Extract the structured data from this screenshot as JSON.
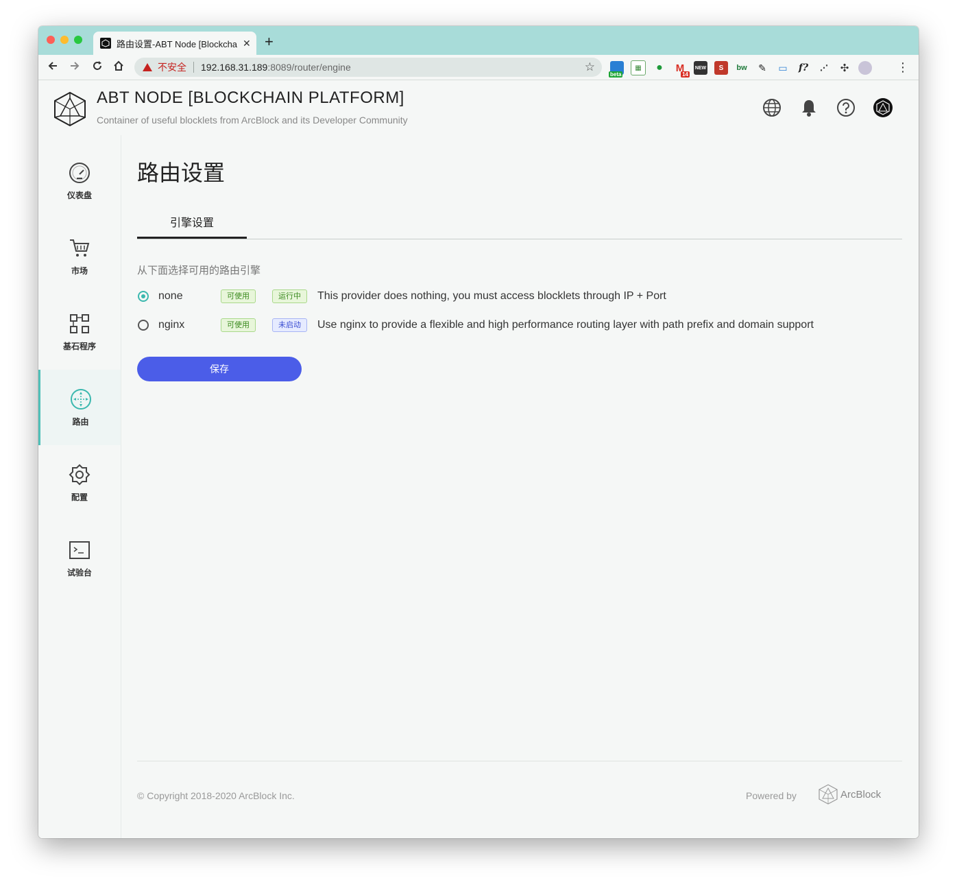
{
  "browser": {
    "tab_title": "路由设置-ABT Node [Blockchain Platform]",
    "new_tab": "+",
    "close": "✕",
    "security_label": "不安全",
    "url_host": "192.168.31.189",
    "url_rest": ":8089/router/engine",
    "ext_badges": {
      "beta": "beta",
      "mail_count": "14"
    }
  },
  "header": {
    "title": "ABT NODE [BLOCKCHAIN PLATFORM]",
    "subtitle": "Container of useful blocklets from ArcBlock and its Developer Community"
  },
  "sidebar": {
    "items": [
      {
        "label": "仪表盘",
        "icon": "dashboard-icon"
      },
      {
        "label": "市场",
        "icon": "cart-icon"
      },
      {
        "label": "基石程序",
        "icon": "blocklets-icon"
      },
      {
        "label": "路由",
        "icon": "router-icon",
        "active": true
      },
      {
        "label": "配置",
        "icon": "gear-icon"
      },
      {
        "label": "试验台",
        "icon": "terminal-icon"
      }
    ]
  },
  "main": {
    "title": "路由设置",
    "tabs": [
      {
        "label": "引擎设置",
        "active": true
      }
    ],
    "instruction": "从下面选择可用的路由引擎",
    "providers": [
      {
        "name": "none",
        "badge1": "可使用",
        "badge2": "运行中",
        "description": "This provider does nothing, you must access blocklets through IP + Port",
        "selected": true
      },
      {
        "name": "nginx",
        "badge1": "可使用",
        "badge2": "未启动",
        "description": "Use nginx to provide a flexible and high performance routing layer with path prefix and domain support",
        "selected": false
      }
    ],
    "save_label": "保存"
  },
  "footer": {
    "copyright": "© Copyright 2018-2020  ArcBlock Inc.",
    "powered_by": "Powered by",
    "brand": "ArcBlock"
  },
  "colors": {
    "accent": "#4b5de8",
    "teal": "#3bb8ae",
    "tabbar": "#a8dcd9"
  }
}
